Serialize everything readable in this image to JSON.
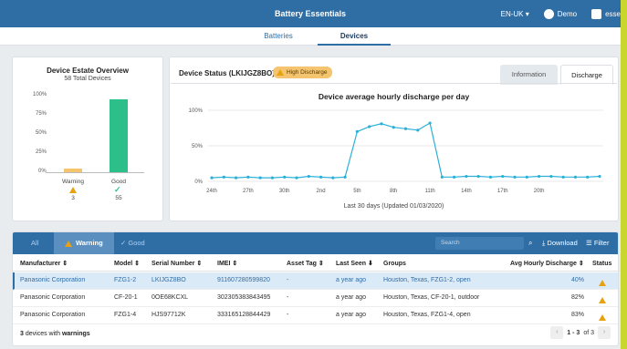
{
  "app": {
    "title": "Battery Essentials"
  },
  "topbar": {
    "locale": "EN-UK ▾",
    "demo": "Demo",
    "user": "esse"
  },
  "nav": {
    "tabs": [
      "Batteries",
      "Devices"
    ],
    "active": "Devices"
  },
  "overview": {
    "title": "Device Estate Overview",
    "subtitle": "58 Total Devices",
    "yticks": [
      "100%",
      "75%",
      "50%",
      "25%",
      "0%"
    ],
    "bars": [
      {
        "label": "Warning",
        "count": "3",
        "percent": 5.2,
        "color": "#f5c46e"
      },
      {
        "label": "Good",
        "count": "55",
        "percent": 94.8,
        "color": "#2dbf8a"
      }
    ]
  },
  "status": {
    "title": "Device Status (LKIJGZ8BO)",
    "badge": "High Discharge",
    "tabs": [
      "Information",
      "Discharge"
    ],
    "active_tab": "Discharge"
  },
  "chart_data": {
    "type": "line",
    "title": "Device average hourly discharge per day",
    "xlabel": "Last 30 days (Updated 01/03/2020)",
    "ylabel": "",
    "ylim": [
      0,
      100
    ],
    "yticks": [
      "100%",
      "50%",
      "0%"
    ],
    "xticks": [
      "24th",
      "27th",
      "30th",
      "2nd",
      "5th",
      "8th",
      "11th",
      "14th",
      "17th",
      "20th"
    ],
    "series": [
      {
        "values": [
          5,
          6,
          5,
          6,
          5,
          5,
          6,
          5,
          7,
          6,
          5,
          6,
          70,
          77,
          81,
          76,
          74,
          72,
          82,
          6,
          6,
          7,
          7,
          6,
          7,
          6,
          6,
          7,
          7,
          6,
          6,
          6,
          7
        ],
        "color": "#2ab0d8"
      }
    ]
  },
  "table": {
    "filters": {
      "all": "All",
      "warning": "Warning",
      "good": "Good"
    },
    "search_placeholder": "Search",
    "download": "Download",
    "filter": "Filter",
    "columns": [
      "Manufacturer ⇕",
      "Model ⇕",
      "Serial Number ⇕",
      "IMEI ⇕",
      "Asset Tag ⇕",
      "Last Seen ⬇",
      "Groups",
      "Avg Hourly Discharge ⇕",
      "Status"
    ],
    "rows": [
      {
        "manufacturer": "Panasonic Corporation",
        "model": "FZG1-2",
        "serial": "LKIJGZ8BO",
        "imei": "911607280599820",
        "asset": "-",
        "last_seen": "a year ago",
        "groups": "Houston, Texas, FZG1-2, open",
        "discharge": "40%"
      },
      {
        "manufacturer": "Panasonic Corporation",
        "model": "CF-20-1",
        "serial": "0OE68KCXL",
        "imei": "302305383843495",
        "asset": "-",
        "last_seen": "a year ago",
        "groups": "Houston, Texas, CF-20-1, outdoor",
        "discharge": "82%"
      },
      {
        "manufacturer": "Panasonic Corporation",
        "model": "FZG1-4",
        "serial": "HJS97712K",
        "imei": "333165128844429",
        "asset": "-",
        "last_seen": "a year ago",
        "groups": "Houston, Texas, FZG1-4, open",
        "discharge": "83%"
      }
    ],
    "footer_count": "3",
    "footer_text": " devices with ",
    "footer_bold": "warnings",
    "pager_range": "1 - 3",
    "pager_of": " of 3"
  }
}
